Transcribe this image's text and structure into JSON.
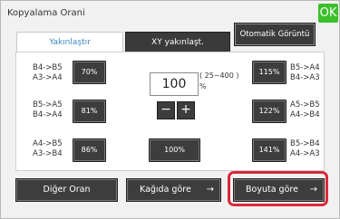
{
  "header": {
    "title": "Kopyalama Orani",
    "ok_label": "OK"
  },
  "tabs": [
    {
      "label": "Yakınlaştır",
      "active": true
    },
    {
      "label": "XY yakınlaşt.",
      "active": false
    }
  ],
  "auto_button_label": "Otomatik Görüntü",
  "presets_left": [
    {
      "label_line1": "B4->B5",
      "label_line2": "A3->A4",
      "button": "70%"
    },
    {
      "label_line1": "B5->A5",
      "label_line2": "B4->A4",
      "button": "81%"
    },
    {
      "label_line1": "A4->B5",
      "label_line2": "A3->B4",
      "button": "86%"
    }
  ],
  "presets_right": [
    {
      "button": "115%",
      "label_line1": "B5->A4",
      "label_line2": "B4->A3"
    },
    {
      "button": "122%",
      "label_line1": "A5->B5",
      "label_line2": "A4->B4"
    },
    {
      "button": "141%",
      "label_line1": "B5->B4",
      "label_line2": "A4->A3"
    }
  ],
  "ratio": {
    "value": "100",
    "range": "( 25~400 )",
    "unit": "%"
  },
  "steppers": {
    "minus": "−",
    "plus": "+"
  },
  "center_button": "100%",
  "bottom": [
    {
      "label": "Diğer Oran"
    },
    {
      "label": "Kağıda göre",
      "arrow": "→"
    },
    {
      "label": "Boyuta göre",
      "arrow": "→"
    }
  ],
  "colors": {
    "highlight": "#d72a3b",
    "ok": "#3bbf2a",
    "active_tab_text": "#3d89c6"
  }
}
